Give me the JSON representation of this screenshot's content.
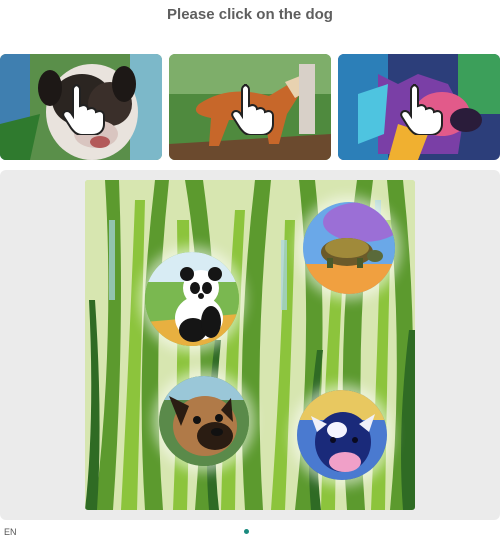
{
  "captcha": {
    "prompt": "Please click on the dog"
  },
  "examples": [
    {
      "name": "example-dog-1",
      "icon": "pointer-hand-icon"
    },
    {
      "name": "example-dog-2",
      "icon": "pointer-hand-icon"
    },
    {
      "name": "example-dog-3",
      "icon": "pointer-hand-icon"
    }
  ],
  "challenge": {
    "animals": [
      "turtle",
      "panda",
      "dog",
      "cow"
    ],
    "background": "tall grass painting"
  },
  "footer": {
    "left_text": "EN"
  },
  "colors": {
    "prompt_text": "#5f5f5f",
    "panel_bg": "#ebebeb",
    "accent": "#1a8a7e"
  }
}
